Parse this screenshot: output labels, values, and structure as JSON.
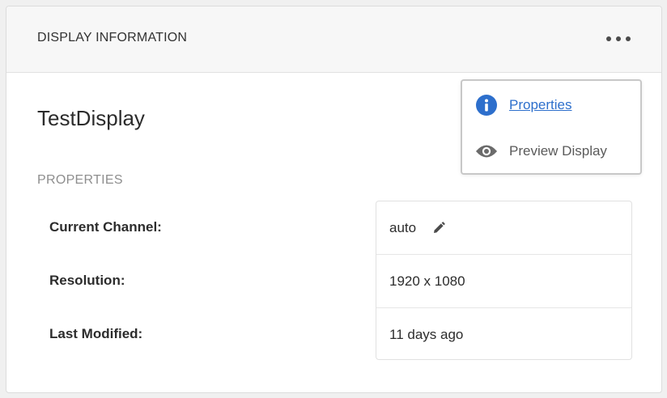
{
  "header": {
    "title": "DISPLAY INFORMATION",
    "more_icon": "more-horizontal-icon"
  },
  "display": {
    "name": "TestDisplay"
  },
  "properties": {
    "heading": "PROPERTIES",
    "rows": [
      {
        "label": "Current Channel:",
        "value": "auto",
        "editable": true
      },
      {
        "label": "Resolution:",
        "value": "1920 x 1080"
      },
      {
        "label": "Last Modified:",
        "value": "11 days ago"
      }
    ]
  },
  "menu": {
    "items": [
      {
        "label": "Properties",
        "icon": "info-icon",
        "active": true
      },
      {
        "label": "Preview Display",
        "icon": "eye-icon"
      }
    ]
  },
  "colors": {
    "accent": "#2d6fcc",
    "info_icon": "#2d6fcc",
    "muted_icon": "#6b6b6b"
  }
}
